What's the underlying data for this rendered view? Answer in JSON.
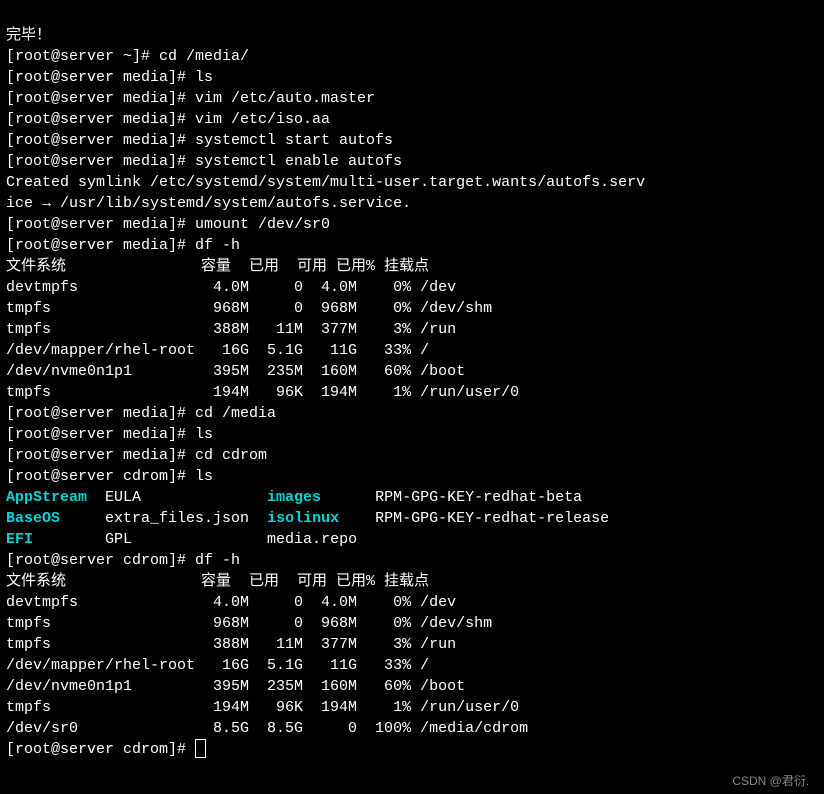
{
  "lines": {
    "l0": "完毕！",
    "l1": "[root@server ~]# cd /media/",
    "l2": "[root@server media]# ls",
    "l3": "[root@server media]# vim /etc/auto.master",
    "l4": "[root@server media]# vim /etc/iso.aa",
    "l5": "[root@server media]# systemctl start autofs",
    "l6": "[root@server media]# systemctl enable autofs",
    "l7": "Created symlink /etc/systemd/system/multi-user.target.wants/autofs.serv",
    "l8": "ice → /usr/lib/systemd/system/autofs.service.",
    "l9": "[root@server media]# umount /dev/sr0",
    "l10": "[root@server media]# df -h",
    "l11": "文件系统               容量  已用  可用 已用% 挂载点",
    "l12": "devtmpfs               4.0M     0  4.0M    0% /dev",
    "l13": "tmpfs                  968M     0  968M    0% /dev/shm",
    "l14": "tmpfs                  388M   11M  377M    3% /run",
    "l15": "/dev/mapper/rhel-root   16G  5.1G   11G   33% /",
    "l16": "/dev/nvme0n1p1         395M  235M  160M   60% /boot",
    "l17": "tmpfs                  194M   96K  194M    1% /run/user/0",
    "l18": "[root@server media]# cd /media",
    "l19": "[root@server media]# ls",
    "l20": "[root@server media]# cd cdrom",
    "l21": "[root@server cdrom]# ls",
    "ls1_c1": "AppStream",
    "ls1_c2": "  EULA              ",
    "ls1_c3": "images",
    "ls1_c4": "      RPM-GPG-KEY-redhat-beta",
    "ls2_c1": "BaseOS",
    "ls2_c2": "     extra_files.json  ",
    "ls2_c3": "isolinux",
    "ls2_c4": "    RPM-GPG-KEY-redhat-release",
    "ls3_c1": "EFI",
    "ls3_c2": "        GPL               media.repo",
    "l25": "[root@server cdrom]# df -h",
    "l26": "文件系统               容量  已用  可用 已用% 挂载点",
    "l27": "devtmpfs               4.0M     0  4.0M    0% /dev",
    "l28": "tmpfs                  968M     0  968M    0% /dev/shm",
    "l29": "tmpfs                  388M   11M  377M    3% /run",
    "l30": "/dev/mapper/rhel-root   16G  5.1G   11G   33% /",
    "l31": "/dev/nvme0n1p1         395M  235M  160M   60% /boot",
    "l32": "tmpfs                  194M   96K  194M    1% /run/user/0",
    "l33": "/dev/sr0               8.5G  8.5G     0  100% /media/cdrom",
    "l34": "[root@server cdrom]# "
  },
  "watermark": "CSDN @君衍.⠀",
  "chart_data_note": "not-a-chart"
}
